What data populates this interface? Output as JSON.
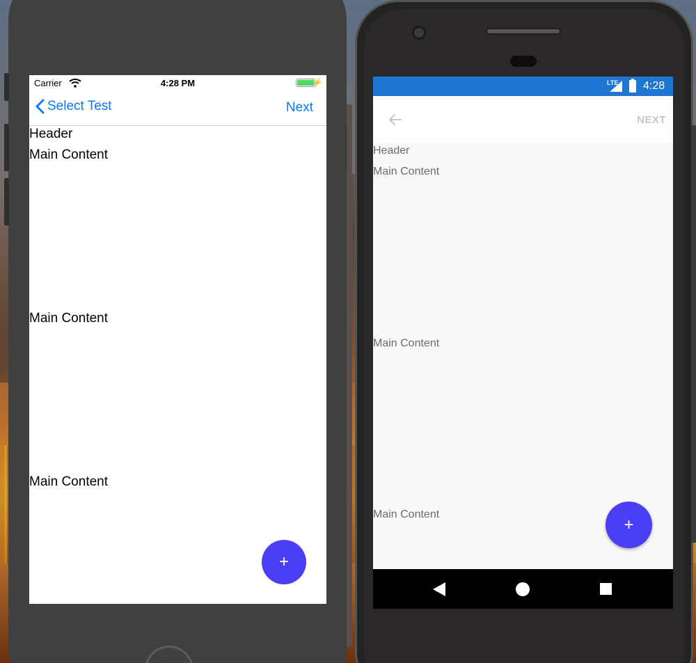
{
  "ios": {
    "status": {
      "carrier": "Carrier",
      "time": "4:28 PM"
    },
    "nav": {
      "back_label": "Select Test",
      "next_label": "Next"
    },
    "content": {
      "header": "Header",
      "items": [
        "Main Content",
        "Main Content",
        "Main Content"
      ]
    },
    "fab_label": "+"
  },
  "android": {
    "status": {
      "network": "LTE",
      "time": "4:28"
    },
    "toolbar": {
      "next_label": "NEXT"
    },
    "content": {
      "header": "Header",
      "items": [
        "Main Content",
        "Main Content",
        "Main Content"
      ]
    },
    "fab_label": "+"
  },
  "colors": {
    "ios_tint": "#0a7aff",
    "fab": "#4a3ff5",
    "android_status_bar": "#1e76d2"
  }
}
